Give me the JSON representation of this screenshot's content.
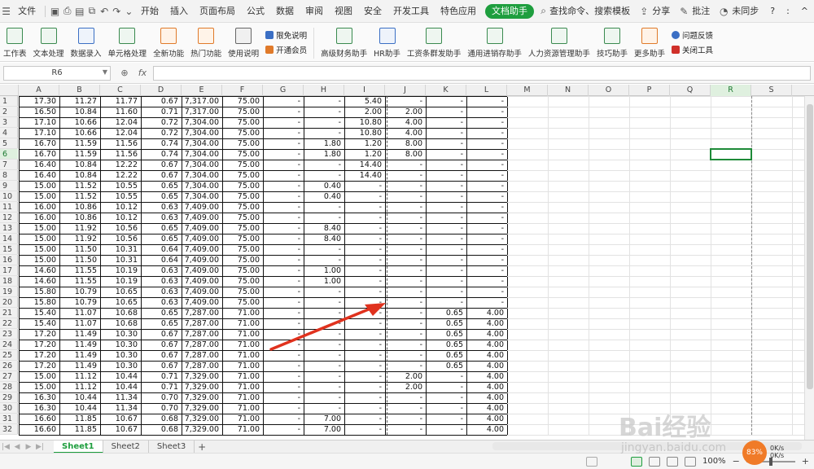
{
  "menubar": {
    "file": "文件",
    "tabs": [
      "开始",
      "插入",
      "页面布局",
      "公式",
      "数据",
      "审阅",
      "视图",
      "安全",
      "开发工具",
      "特色应用"
    ],
    "active_tab": "文档助手",
    "search": "查找命令、搜索模板",
    "share": "分享",
    "comment": "批注",
    "sync": "未同步",
    "help": "?",
    "more": ":",
    "collapse": "^"
  },
  "ribbon": {
    "buttons": [
      {
        "label": "工作表",
        "name": "worksheet-button"
      },
      {
        "label": "文本处理",
        "name": "text-process-button"
      },
      {
        "label": "数据录入",
        "name": "data-entry-button"
      },
      {
        "label": "单元格处理",
        "name": "cell-process-button"
      },
      {
        "label": "全新功能",
        "name": "new-features-button"
      },
      {
        "label": "热门功能",
        "name": "hot-features-button"
      },
      {
        "label": "使用说明",
        "name": "usage-guide-button"
      }
    ],
    "small_top": "限免说明",
    "small_bottom": "开通会员",
    "buttons2": [
      {
        "label": "高级财务助手",
        "name": "finance-assistant-button"
      },
      {
        "label": "HR助手",
        "name": "hr-assistant-button"
      },
      {
        "label": "工资条群发助手",
        "name": "payslip-assistant-button"
      },
      {
        "label": "通用进销存助手",
        "name": "inventory-assistant-button"
      },
      {
        "label": "人力资源管理助手",
        "name": "hrm-assistant-button"
      },
      {
        "label": "技巧助手",
        "name": "tips-assistant-button"
      },
      {
        "label": "更多助手",
        "name": "more-assistant-button"
      }
    ],
    "feedback": "问题反馈",
    "close_tool": "关闭工具"
  },
  "formula_bar": {
    "name_box": "R6",
    "fx": "fx",
    "value": ""
  },
  "grid": {
    "columns": [
      "A",
      "B",
      "C",
      "D",
      "E",
      "F",
      "G",
      "H",
      "I",
      "J",
      "K",
      "L",
      "M",
      "N",
      "O",
      "P",
      "Q",
      "R",
      "S"
    ],
    "selected_column": "R",
    "selected_row": 6,
    "rows": [
      [
        "17.30",
        "11.27",
        "11.77",
        "0.67",
        "7,317.00",
        "75.00",
        "-",
        "-",
        "5.40",
        "-",
        "-",
        "-"
      ],
      [
        "16.50",
        "10.84",
        "11.60",
        "0.71",
        "7,317.00",
        "75.00",
        "-",
        "-",
        "2.00",
        "2.00",
        "-",
        "-"
      ],
      [
        "17.10",
        "10.66",
        "12.04",
        "0.72",
        "7,304.00",
        "75.00",
        "-",
        "-",
        "10.80",
        "4.00",
        "-",
        "-"
      ],
      [
        "17.10",
        "10.66",
        "12.04",
        "0.72",
        "7,304.00",
        "75.00",
        "-",
        "-",
        "10.80",
        "4.00",
        "-",
        "-"
      ],
      [
        "16.70",
        "11.59",
        "11.56",
        "0.74",
        "7,304.00",
        "75.00",
        "-",
        "1.80",
        "1.20",
        "8.00",
        "-",
        "-"
      ],
      [
        "16.70",
        "11.59",
        "11.56",
        "0.74",
        "7,304.00",
        "75.00",
        "-",
        "1.80",
        "1.20",
        "8.00",
        "-",
        "-"
      ],
      [
        "16.40",
        "10.84",
        "12.22",
        "0.67",
        "7,304.00",
        "75.00",
        "-",
        "-",
        "14.40",
        "-",
        "-",
        "-"
      ],
      [
        "16.40",
        "10.84",
        "12.22",
        "0.67",
        "7,304.00",
        "75.00",
        "-",
        "-",
        "14.40",
        "-",
        "-",
        "-"
      ],
      [
        "15.00",
        "11.52",
        "10.55",
        "0.65",
        "7,304.00",
        "75.00",
        "-",
        "0.40",
        "-",
        "-",
        "-",
        "-"
      ],
      [
        "15.00",
        "11.52",
        "10.55",
        "0.65",
        "7,304.00",
        "75.00",
        "-",
        "0.40",
        "-",
        "-",
        "-",
        "-"
      ],
      [
        "16.00",
        "10.86",
        "10.12",
        "0.63",
        "7,409.00",
        "75.00",
        "-",
        "-",
        "-",
        "-",
        "-",
        "-"
      ],
      [
        "16.00",
        "10.86",
        "10.12",
        "0.63",
        "7,409.00",
        "75.00",
        "-",
        "-",
        "-",
        "-",
        "-",
        "-"
      ],
      [
        "15.00",
        "11.92",
        "10.56",
        "0.65",
        "7,409.00",
        "75.00",
        "-",
        "8.40",
        "-",
        "-",
        "-",
        "-"
      ],
      [
        "15.00",
        "11.92",
        "10.56",
        "0.65",
        "7,409.00",
        "75.00",
        "-",
        "8.40",
        "-",
        "-",
        "-",
        "-"
      ],
      [
        "15.00",
        "11.50",
        "10.31",
        "0.64",
        "7,409.00",
        "75.00",
        "-",
        "-",
        "-",
        "-",
        "-",
        "-"
      ],
      [
        "15.00",
        "11.50",
        "10.31",
        "0.64",
        "7,409.00",
        "75.00",
        "-",
        "-",
        "-",
        "-",
        "-",
        "-"
      ],
      [
        "14.60",
        "11.55",
        "10.19",
        "0.63",
        "7,409.00",
        "75.00",
        "-",
        "1.00",
        "-",
        "-",
        "-",
        "-"
      ],
      [
        "14.60",
        "11.55",
        "10.19",
        "0.63",
        "7,409.00",
        "75.00",
        "-",
        "1.00",
        "-",
        "-",
        "-",
        "-"
      ],
      [
        "15.80",
        "10.79",
        "10.65",
        "0.63",
        "7,409.00",
        "75.00",
        "-",
        "-",
        "-",
        "-",
        "-",
        "-"
      ],
      [
        "15.80",
        "10.79",
        "10.65",
        "0.63",
        "7,409.00",
        "75.00",
        "-",
        "-",
        "-",
        "-",
        "-",
        "-"
      ],
      [
        "15.40",
        "11.07",
        "10.68",
        "0.65",
        "7,287.00",
        "71.00",
        "-",
        "-",
        "-",
        "-",
        "0.65",
        "4.00"
      ],
      [
        "15.40",
        "11.07",
        "10.68",
        "0.65",
        "7,287.00",
        "71.00",
        "-",
        "-",
        "-",
        "-",
        "0.65",
        "4.00"
      ],
      [
        "17.20",
        "11.49",
        "10.30",
        "0.67",
        "7,287.00",
        "71.00",
        "-",
        "-",
        "-",
        "-",
        "0.65",
        "4.00"
      ],
      [
        "17.20",
        "11.49",
        "10.30",
        "0.67",
        "7,287.00",
        "71.00",
        "-",
        "-",
        "-",
        "-",
        "0.65",
        "4.00"
      ],
      [
        "17.20",
        "11.49",
        "10.30",
        "0.67",
        "7,287.00",
        "71.00",
        "-",
        "-",
        "-",
        "-",
        "0.65",
        "4.00"
      ],
      [
        "17.20",
        "11.49",
        "10.30",
        "0.67",
        "7,287.00",
        "71.00",
        "-",
        "-",
        "-",
        "-",
        "0.65",
        "4.00"
      ],
      [
        "15.00",
        "11.12",
        "10.44",
        "0.71",
        "7,329.00",
        "71.00",
        "-",
        "-",
        "-",
        "2.00",
        "-",
        "4.00"
      ],
      [
        "15.00",
        "11.12",
        "10.44",
        "0.71",
        "7,329.00",
        "71.00",
        "-",
        "-",
        "-",
        "2.00",
        "-",
        "4.00"
      ],
      [
        "16.30",
        "10.44",
        "11.34",
        "0.70",
        "7,329.00",
        "71.00",
        "-",
        "-",
        "-",
        "-",
        "-",
        "4.00"
      ],
      [
        "16.30",
        "10.44",
        "11.34",
        "0.70",
        "7,329.00",
        "71.00",
        "-",
        "-",
        "-",
        "-",
        "-",
        "4.00"
      ],
      [
        "16.60",
        "11.85",
        "10.67",
        "0.68",
        "7,329.00",
        "71.00",
        "-",
        "7.00",
        "-",
        "-",
        "-",
        "4.00"
      ],
      [
        "16.60",
        "11.85",
        "10.67",
        "0.68",
        "7,329.00",
        "71.00",
        "-",
        "7.00",
        "-",
        "-",
        "-",
        "4.00"
      ]
    ]
  },
  "sheets": {
    "tabs": [
      "Sheet1",
      "Sheet2",
      "Sheet3"
    ],
    "active": "Sheet1",
    "add": "+"
  },
  "status": {
    "zoom": "100%",
    "minus": "−",
    "plus": "+",
    "speed_badge": "83%",
    "speed_up": "0K/s",
    "speed_down": "0K/s"
  },
  "watermark": {
    "brand": "Bai经验",
    "url": "jingyan.baidu.com"
  },
  "colors": {
    "accent": "#1e9e3e",
    "arrow": "#e0321e"
  }
}
